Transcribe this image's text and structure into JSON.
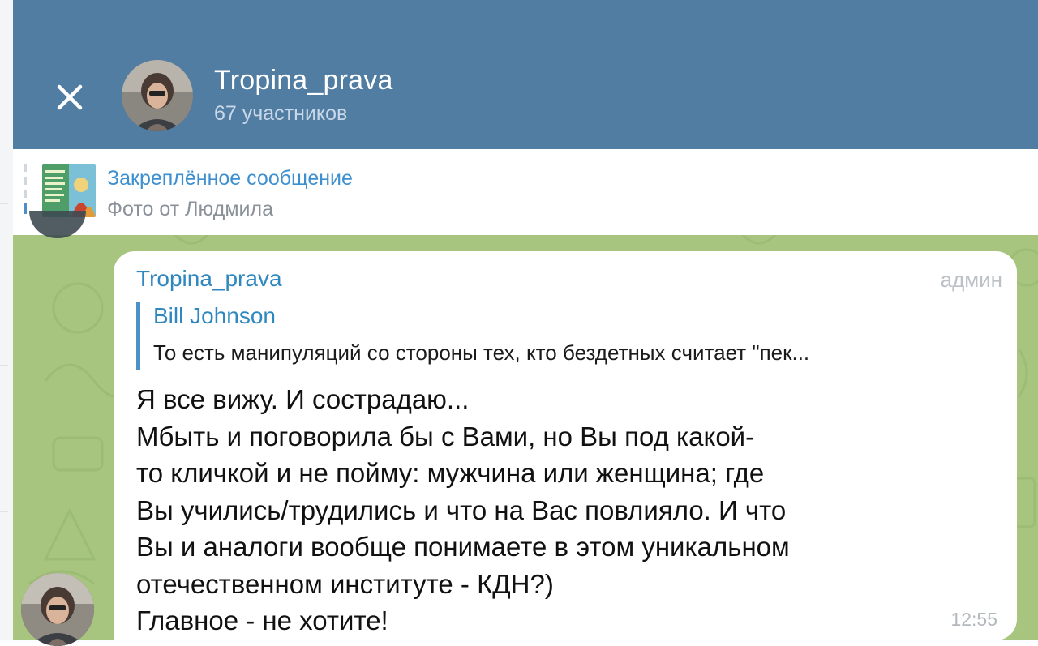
{
  "header": {
    "close_icon": "close-icon",
    "title": "Tropina_prava",
    "subtitle": "67 участников",
    "colors": {
      "background": "#517da2",
      "title": "#ffffff",
      "subtitle": "#c8d8e8"
    }
  },
  "pinned": {
    "title": "Закреплённое сообщение",
    "subtitle": "Фото от Людмила",
    "thumbnail_icon": "pinned-photo-thumbnail"
  },
  "message": {
    "sender": "Tropina_prava",
    "role": "админ",
    "reply": {
      "author": "Bill Johnson",
      "text": "То есть манипуляций со стороны тех, кто бездетных считает \"пек..."
    },
    "lines": [
      "Я все вижу. И сострадаю...",
      "Мбыть и поговорила бы с Вами, но Вы под какой-",
      "то кличкой и не пойму: мужчина или женщина; где",
      "Вы учились/трудились и что на Вас повлияло. И что",
      "Вы и аналоги вообще понимаете в этом уникальном",
      "отечественном институте - КДН?)",
      "Главное - не хотите!"
    ],
    "time": "12:55"
  },
  "colors": {
    "chat_background": "#a7c57f",
    "link": "#2f87bf",
    "pinned_title": "#3d8fcf"
  }
}
